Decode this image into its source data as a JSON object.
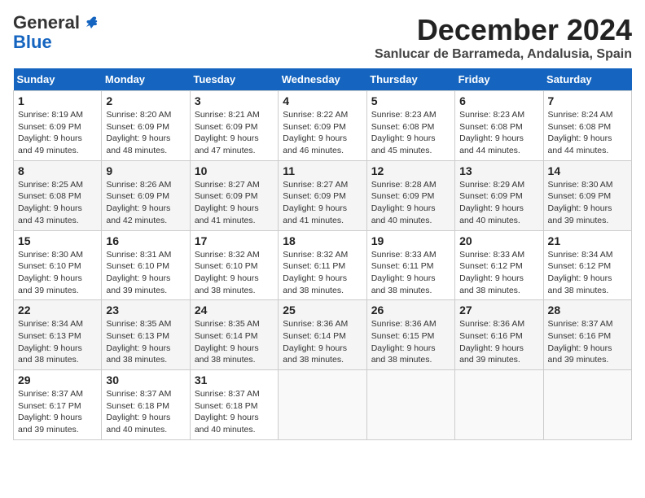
{
  "header": {
    "logo_general": "General",
    "logo_blue": "Blue",
    "month": "December 2024",
    "location": "Sanlucar de Barrameda, Andalusia, Spain"
  },
  "weekdays": [
    "Sunday",
    "Monday",
    "Tuesday",
    "Wednesday",
    "Thursday",
    "Friday",
    "Saturday"
  ],
  "weeks": [
    [
      {
        "day": "1",
        "sunrise": "8:19 AM",
        "sunset": "6:09 PM",
        "daylight": "9 hours and 49 minutes."
      },
      {
        "day": "2",
        "sunrise": "8:20 AM",
        "sunset": "6:09 PM",
        "daylight": "9 hours and 48 minutes."
      },
      {
        "day": "3",
        "sunrise": "8:21 AM",
        "sunset": "6:09 PM",
        "daylight": "9 hours and 47 minutes."
      },
      {
        "day": "4",
        "sunrise": "8:22 AM",
        "sunset": "6:09 PM",
        "daylight": "9 hours and 46 minutes."
      },
      {
        "day": "5",
        "sunrise": "8:23 AM",
        "sunset": "6:08 PM",
        "daylight": "9 hours and 45 minutes."
      },
      {
        "day": "6",
        "sunrise": "8:23 AM",
        "sunset": "6:08 PM",
        "daylight": "9 hours and 44 minutes."
      },
      {
        "day": "7",
        "sunrise": "8:24 AM",
        "sunset": "6:08 PM",
        "daylight": "9 hours and 44 minutes."
      }
    ],
    [
      {
        "day": "8",
        "sunrise": "8:25 AM",
        "sunset": "6:08 PM",
        "daylight": "9 hours and 43 minutes."
      },
      {
        "day": "9",
        "sunrise": "8:26 AM",
        "sunset": "6:09 PM",
        "daylight": "9 hours and 42 minutes."
      },
      {
        "day": "10",
        "sunrise": "8:27 AM",
        "sunset": "6:09 PM",
        "daylight": "9 hours and 41 minutes."
      },
      {
        "day": "11",
        "sunrise": "8:27 AM",
        "sunset": "6:09 PM",
        "daylight": "9 hours and 41 minutes."
      },
      {
        "day": "12",
        "sunrise": "8:28 AM",
        "sunset": "6:09 PM",
        "daylight": "9 hours and 40 minutes."
      },
      {
        "day": "13",
        "sunrise": "8:29 AM",
        "sunset": "6:09 PM",
        "daylight": "9 hours and 40 minutes."
      },
      {
        "day": "14",
        "sunrise": "8:30 AM",
        "sunset": "6:09 PM",
        "daylight": "9 hours and 39 minutes."
      }
    ],
    [
      {
        "day": "15",
        "sunrise": "8:30 AM",
        "sunset": "6:10 PM",
        "daylight": "9 hours and 39 minutes."
      },
      {
        "day": "16",
        "sunrise": "8:31 AM",
        "sunset": "6:10 PM",
        "daylight": "9 hours and 39 minutes."
      },
      {
        "day": "17",
        "sunrise": "8:32 AM",
        "sunset": "6:10 PM",
        "daylight": "9 hours and 38 minutes."
      },
      {
        "day": "18",
        "sunrise": "8:32 AM",
        "sunset": "6:11 PM",
        "daylight": "9 hours and 38 minutes."
      },
      {
        "day": "19",
        "sunrise": "8:33 AM",
        "sunset": "6:11 PM",
        "daylight": "9 hours and 38 minutes."
      },
      {
        "day": "20",
        "sunrise": "8:33 AM",
        "sunset": "6:12 PM",
        "daylight": "9 hours and 38 minutes."
      },
      {
        "day": "21",
        "sunrise": "8:34 AM",
        "sunset": "6:12 PM",
        "daylight": "9 hours and 38 minutes."
      }
    ],
    [
      {
        "day": "22",
        "sunrise": "8:34 AM",
        "sunset": "6:13 PM",
        "daylight": "9 hours and 38 minutes."
      },
      {
        "day": "23",
        "sunrise": "8:35 AM",
        "sunset": "6:13 PM",
        "daylight": "9 hours and 38 minutes."
      },
      {
        "day": "24",
        "sunrise": "8:35 AM",
        "sunset": "6:14 PM",
        "daylight": "9 hours and 38 minutes."
      },
      {
        "day": "25",
        "sunrise": "8:36 AM",
        "sunset": "6:14 PM",
        "daylight": "9 hours and 38 minutes."
      },
      {
        "day": "26",
        "sunrise": "8:36 AM",
        "sunset": "6:15 PM",
        "daylight": "9 hours and 38 minutes."
      },
      {
        "day": "27",
        "sunrise": "8:36 AM",
        "sunset": "6:16 PM",
        "daylight": "9 hours and 39 minutes."
      },
      {
        "day": "28",
        "sunrise": "8:37 AM",
        "sunset": "6:16 PM",
        "daylight": "9 hours and 39 minutes."
      }
    ],
    [
      {
        "day": "29",
        "sunrise": "8:37 AM",
        "sunset": "6:17 PM",
        "daylight": "9 hours and 39 minutes."
      },
      {
        "day": "30",
        "sunrise": "8:37 AM",
        "sunset": "6:18 PM",
        "daylight": "9 hours and 40 minutes."
      },
      {
        "day": "31",
        "sunrise": "8:37 AM",
        "sunset": "6:18 PM",
        "daylight": "9 hours and 40 minutes."
      },
      null,
      null,
      null,
      null
    ]
  ]
}
